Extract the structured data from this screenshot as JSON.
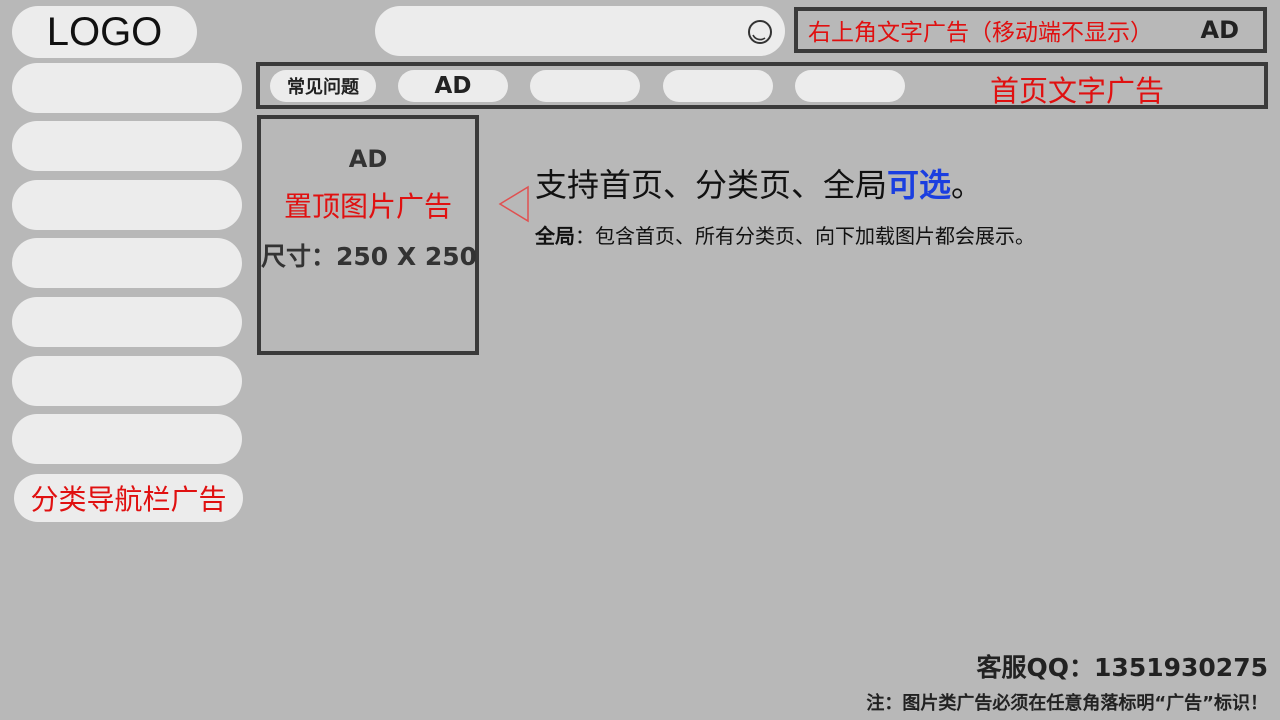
{
  "header": {
    "logo_text": "LOGO",
    "search_icon": "search-icon",
    "top_right_ad_text": "右上角文字广告（移动端不显示）",
    "top_right_ad_mark": "AD"
  },
  "sidebar": {
    "items": [
      "",
      "",
      "",
      "",
      "",
      "",
      ""
    ],
    "ad_label": "分类导航栏广告"
  },
  "nav": {
    "tabs": [
      {
        "label": "常见问题"
      },
      {
        "label": "AD"
      },
      {
        "label": ""
      },
      {
        "label": ""
      },
      {
        "label": ""
      }
    ],
    "text_ad": "首页文字广告"
  },
  "image_ad": {
    "mark": "AD",
    "name": "置顶图片广告",
    "size": "尺寸：250 X 250"
  },
  "description": {
    "title_main": "支持首页、分类页、全局",
    "title_highlight": "可选",
    "title_end": "。",
    "line_label": "全局",
    "line_text": "：包含首页、所有分类页、向下加载图片都会展示。"
  },
  "footer": {
    "service": "客服QQ：1351930275",
    "note": "注：图片类广告必须在任意角落标明“广告”标识！"
  },
  "colors": {
    "background": "#b8b8b8",
    "pill": "#ececec",
    "ad_red": "#e01010",
    "highlight_blue": "#1a3ee0",
    "border": "#3a3a3a"
  }
}
